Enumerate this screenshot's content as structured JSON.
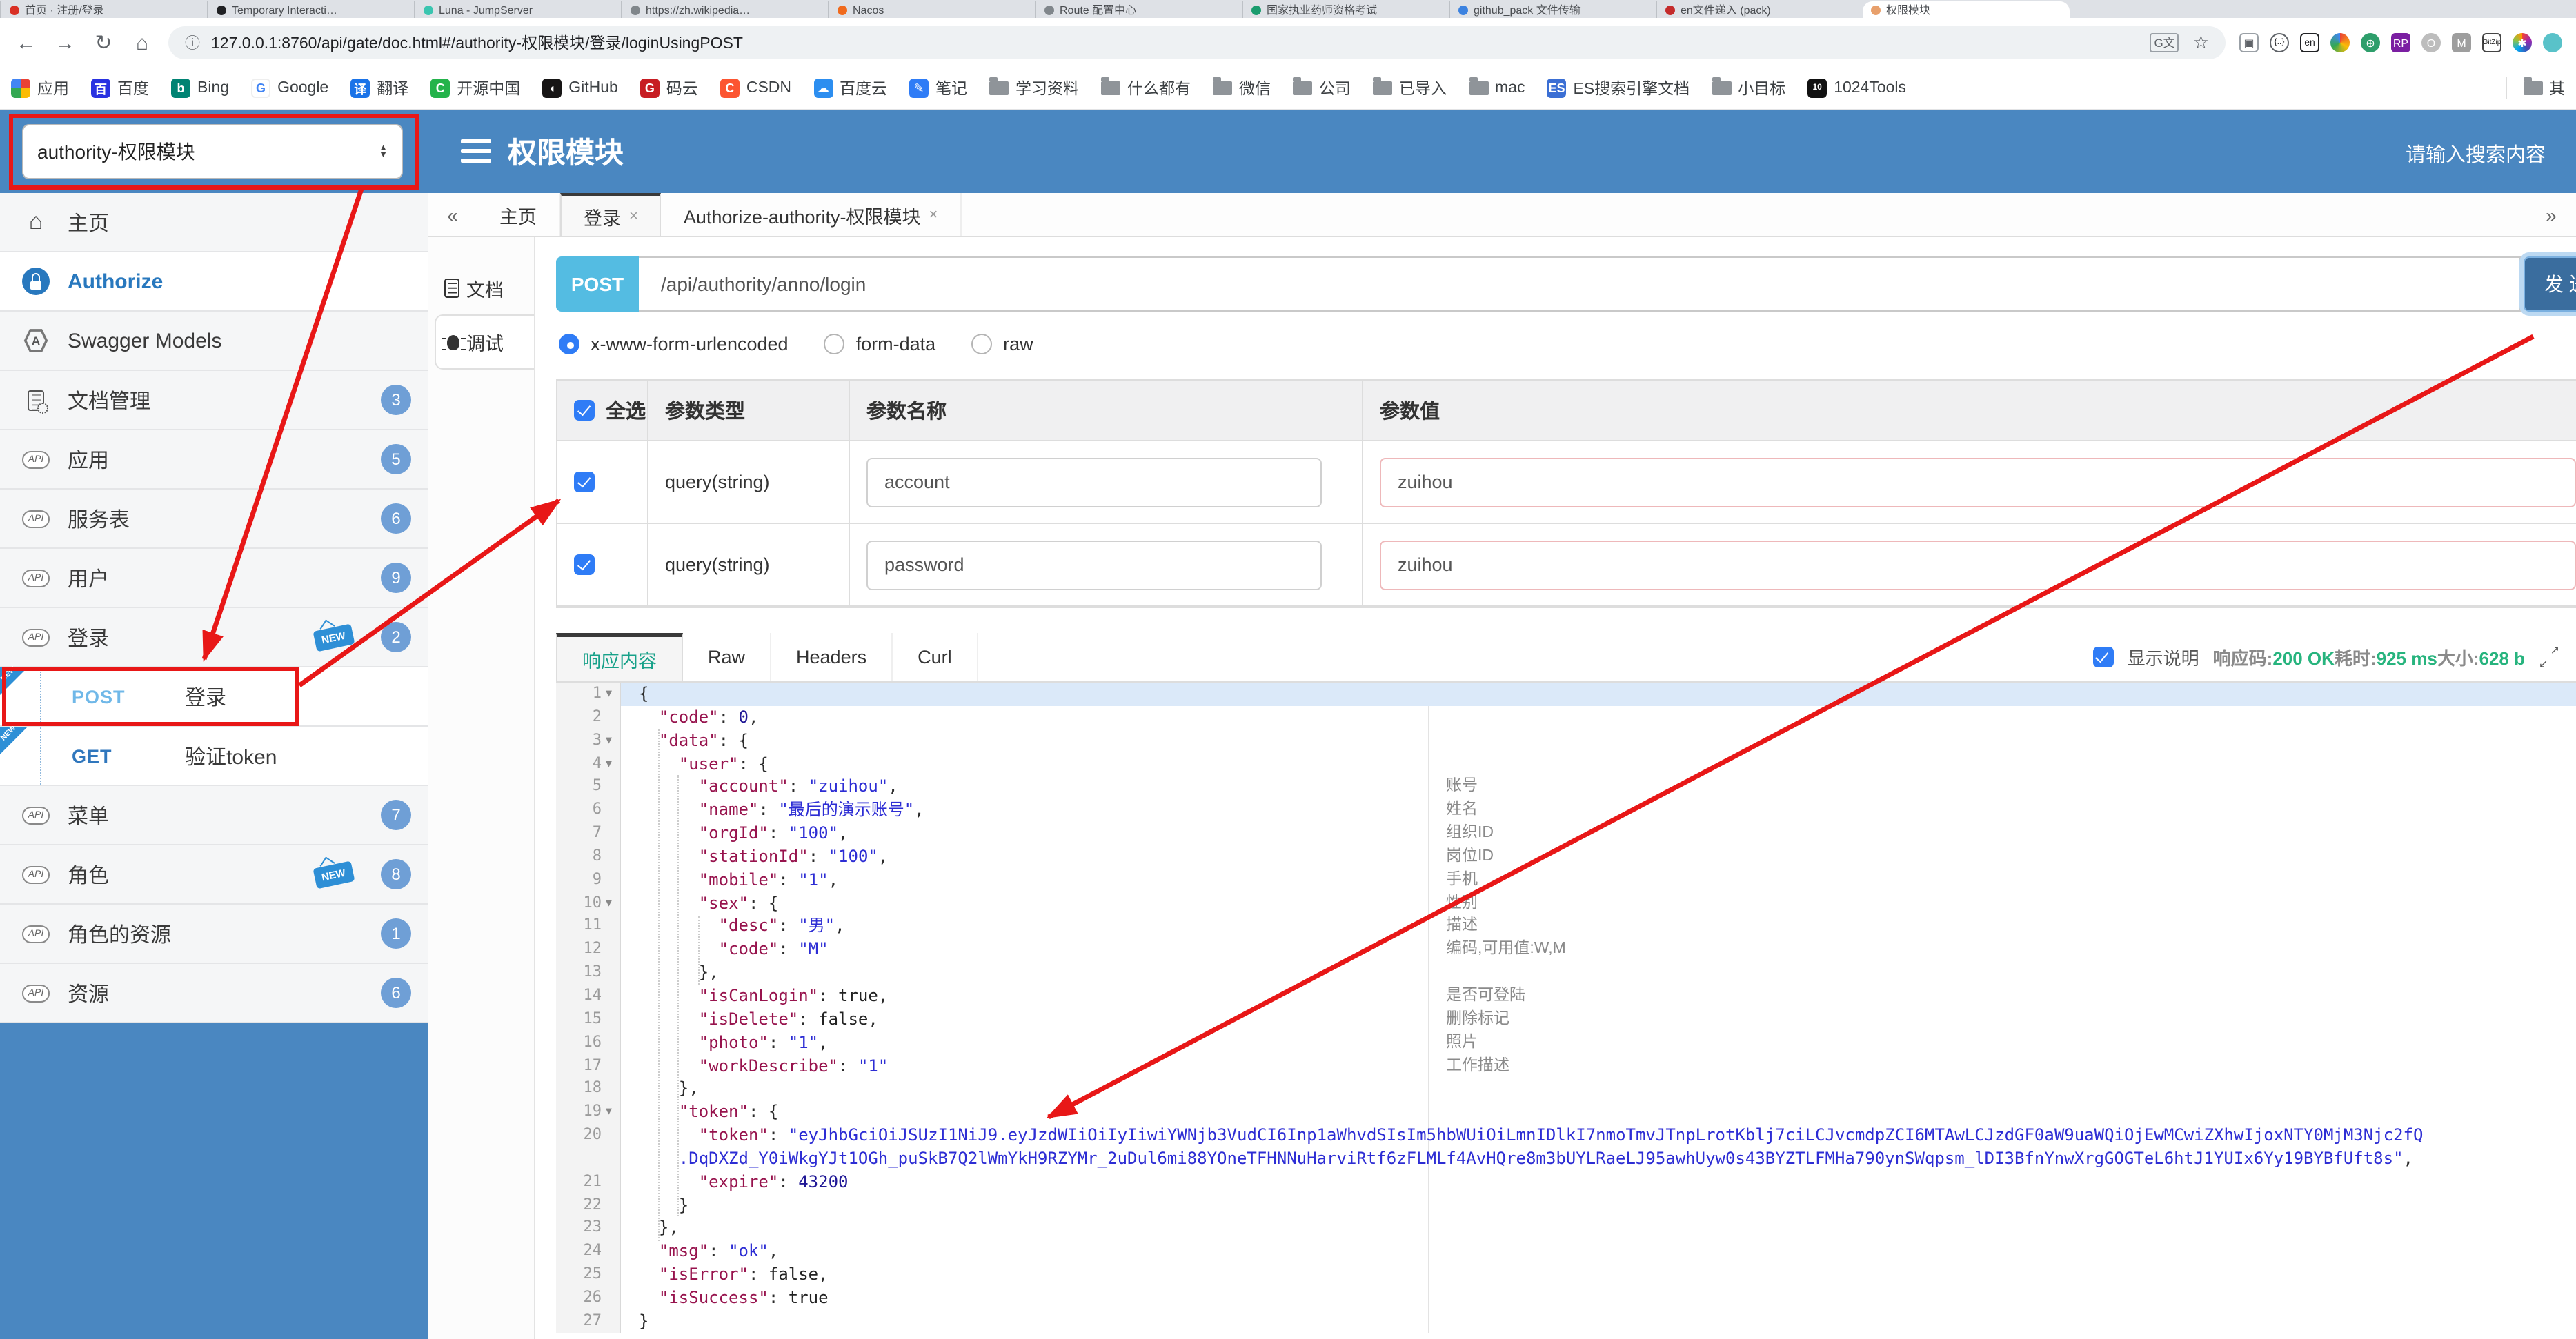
{
  "colors": {
    "header_blue": "#4a87c1",
    "annotation_red": "#e81717",
    "success_green": "#27b47e",
    "active_tab_teal": "#17a189",
    "method_post_chip": "#54bce2"
  },
  "browser": {
    "tabs": [
      {
        "label": "首页 · 注册/登录",
        "color": "#d93025"
      },
      {
        "label": "Temporary Interacti…",
        "color": "#202124"
      },
      {
        "label": "Luna - JumpServer",
        "color": "#3ac5b0"
      },
      {
        "label": "https://zh.wikipedia…",
        "color": "#80868b"
      },
      {
        "label": "Nacos",
        "color": "#f06a1d"
      },
      {
        "label": "Route 配置中心",
        "color": "#80868b"
      },
      {
        "label": "国家执业药师资格考试",
        "color": "#1a9c6e"
      },
      {
        "label": "github_pack 文件传输",
        "color": "#3b82e0"
      },
      {
        "label": "en文件递入 (pack)",
        "color": "#c42b2b"
      },
      {
        "label": "权限模块",
        "color": "#e8a06c",
        "active": true
      }
    ],
    "nav": {
      "url": "127.0.0.1:8760/api/gate/doc.html#/authority-权限模块/登录/loginUsingPOST"
    },
    "bookmarks": [
      {
        "label": "应用",
        "icon": "grid"
      },
      {
        "label": "百度",
        "icon": "baidu"
      },
      {
        "label": "Bing",
        "icon": "bing"
      },
      {
        "label": "Google",
        "icon": "google"
      },
      {
        "label": "翻译",
        "icon": "trans"
      },
      {
        "label": "开源中国",
        "icon": "osc"
      },
      {
        "label": "GitHub",
        "icon": "github"
      },
      {
        "label": "码云",
        "icon": "gitee"
      },
      {
        "label": "CSDN",
        "icon": "csdn"
      },
      {
        "label": "百度云",
        "icon": "bdcloud"
      },
      {
        "label": "笔记",
        "icon": "note"
      },
      {
        "label": "学习资料",
        "icon": "folder"
      },
      {
        "label": "什么都有",
        "icon": "folder"
      },
      {
        "label": "微信",
        "icon": "folder"
      },
      {
        "label": "公司",
        "icon": "folder"
      },
      {
        "label": "已导入",
        "icon": "folder"
      },
      {
        "label": "mac",
        "icon": "folder"
      },
      {
        "label": "ES搜索引擎文档",
        "icon": "es"
      },
      {
        "label": "小目标",
        "icon": "folder"
      },
      {
        "label": "1024Tools",
        "icon": "t1024"
      }
    ],
    "other_bookmarks_label": "其"
  },
  "header": {
    "module_select": "authority-权限模块",
    "title": "权限模块",
    "search_placeholder": "请输入搜索内容"
  },
  "sidebar": {
    "items": [
      {
        "label": "主页",
        "icon": "home"
      },
      {
        "label": "Authorize",
        "icon": "lock",
        "auth": true
      },
      {
        "label": "Swagger Models",
        "icon": "hex"
      },
      {
        "label": "文档管理",
        "icon": "docgear",
        "badge": "3"
      },
      {
        "label": "应用",
        "icon": "api",
        "badge": "5"
      },
      {
        "label": "服务表",
        "icon": "api",
        "badge": "6"
      },
      {
        "label": "用户",
        "icon": "api",
        "badge": "9"
      },
      {
        "label": "登录",
        "icon": "api",
        "badge": "2",
        "new": true
      },
      {
        "label": "登录",
        "method": "POST",
        "op": true,
        "new_corner": true
      },
      {
        "label": "验证token",
        "method": "GET",
        "op": true,
        "new_corner": true
      },
      {
        "label": "菜单",
        "icon": "api",
        "badge": "7"
      },
      {
        "label": "角色",
        "icon": "api",
        "badge": "8",
        "new": true
      },
      {
        "label": "角色的资源",
        "icon": "api",
        "badge": "1"
      },
      {
        "label": "资源",
        "icon": "api",
        "badge": "6"
      }
    ]
  },
  "workspace": {
    "collapse": "«",
    "expand": "»",
    "tabs": [
      {
        "label": "主页"
      },
      {
        "label": "登录",
        "close": "×",
        "active": true
      },
      {
        "label": "Authorize-authority-权限模块",
        "close": "×"
      }
    ],
    "doc_tabs": [
      {
        "label": "文档",
        "icon": "doc"
      },
      {
        "label": "调试",
        "icon": "bug",
        "active": true
      }
    ]
  },
  "request": {
    "method": "POST",
    "url": "/api/authority/anno/login",
    "send_label": "发送",
    "body_types": [
      {
        "label": "x-www-form-urlencoded",
        "selected": true
      },
      {
        "label": "form-data",
        "selected": false
      },
      {
        "label": "raw",
        "selected": false
      }
    ],
    "params": {
      "headers": [
        "全选",
        "参数类型",
        "参数名称",
        "参数值"
      ],
      "rows": [
        {
          "checked": true,
          "type": "query(string)",
          "name": "account",
          "value": "zuihou"
        },
        {
          "checked": true,
          "type": "query(string)",
          "name": "password",
          "value": "zuihou"
        }
      ]
    }
  },
  "response": {
    "tabs": [
      {
        "label": "响应内容",
        "active": true
      },
      {
        "label": "Raw"
      },
      {
        "label": "Headers"
      },
      {
        "label": "Curl"
      }
    ],
    "show_desc_label": "显示说明",
    "show_desc_checked": true,
    "status": [
      {
        "k": "响应码:",
        "v": "200 OK"
      },
      {
        "k": "耗时:",
        "v": "925 ms"
      },
      {
        "k": "大小:",
        "v": "628 b"
      }
    ]
  },
  "code": {
    "lines": [
      {
        "n": "1",
        "f": true,
        "act": true,
        "s": [
          [
            "p",
            "{"
          ]
        ]
      },
      {
        "n": "2",
        "s": [
          [
            "p",
            "  "
          ],
          [
            "k",
            "\"code\""
          ],
          [
            "p",
            ": "
          ],
          [
            "n",
            "0"
          ],
          [
            "p",
            ","
          ]
        ]
      },
      {
        "n": "3",
        "f": true,
        "s": [
          [
            "p",
            "  "
          ],
          [
            "k",
            "\"data\""
          ],
          [
            "p",
            ": {"
          ]
        ]
      },
      {
        "n": "4",
        "f": true,
        "s": [
          [
            "p",
            "    "
          ],
          [
            "k",
            "\"user\""
          ],
          [
            "p",
            ": {"
          ]
        ]
      },
      {
        "n": "5",
        "c": "账号",
        "s": [
          [
            "p",
            "      "
          ],
          [
            "k",
            "\"account\""
          ],
          [
            "p",
            ": "
          ],
          [
            "s",
            "\"zuihou\""
          ],
          [
            "p",
            ","
          ]
        ]
      },
      {
        "n": "6",
        "c": "姓名",
        "s": [
          [
            "p",
            "      "
          ],
          [
            "k",
            "\"name\""
          ],
          [
            "p",
            ": "
          ],
          [
            "s",
            "\"最后的演示账号\""
          ],
          [
            "p",
            ","
          ]
        ]
      },
      {
        "n": "7",
        "c": "组织ID",
        "s": [
          [
            "p",
            "      "
          ],
          [
            "k",
            "\"orgId\""
          ],
          [
            "p",
            ": "
          ],
          [
            "s",
            "\"100\""
          ],
          [
            "p",
            ","
          ]
        ]
      },
      {
        "n": "8",
        "c": "岗位ID",
        "s": [
          [
            "p",
            "      "
          ],
          [
            "k",
            "\"stationId\""
          ],
          [
            "p",
            ": "
          ],
          [
            "s",
            "\"100\""
          ],
          [
            "p",
            ","
          ]
        ]
      },
      {
        "n": "9",
        "c": "手机",
        "s": [
          [
            "p",
            "      "
          ],
          [
            "k",
            "\"mobile\""
          ],
          [
            "p",
            ": "
          ],
          [
            "s",
            "\"1\""
          ],
          [
            "p",
            ","
          ]
        ]
      },
      {
        "n": "10",
        "f": true,
        "c": "性别",
        "s": [
          [
            "p",
            "      "
          ],
          [
            "k",
            "\"sex\""
          ],
          [
            "p",
            ": {"
          ]
        ]
      },
      {
        "n": "11",
        "c": "描述",
        "s": [
          [
            "p",
            "        "
          ],
          [
            "k",
            "\"desc\""
          ],
          [
            "p",
            ": "
          ],
          [
            "s",
            "\"男\""
          ],
          [
            "p",
            ","
          ]
        ]
      },
      {
        "n": "12",
        "c": "编码,可用值:W,M",
        "s": [
          [
            "p",
            "        "
          ],
          [
            "k",
            "\"code\""
          ],
          [
            "p",
            ": "
          ],
          [
            "s",
            "\"M\""
          ]
        ]
      },
      {
        "n": "13",
        "s": [
          [
            "p",
            "      },"
          ]
        ]
      },
      {
        "n": "14",
        "c": "是否可登陆",
        "s": [
          [
            "p",
            "      "
          ],
          [
            "k",
            "\"isCanLogin\""
          ],
          [
            "p",
            ": "
          ],
          [
            "b",
            "true"
          ],
          [
            "p",
            ","
          ]
        ]
      },
      {
        "n": "15",
        "c": "删除标记",
        "s": [
          [
            "p",
            "      "
          ],
          [
            "k",
            "\"isDelete\""
          ],
          [
            "p",
            ": "
          ],
          [
            "b",
            "false"
          ],
          [
            "p",
            ","
          ]
        ]
      },
      {
        "n": "16",
        "c": "照片",
        "s": [
          [
            "p",
            "      "
          ],
          [
            "k",
            "\"photo\""
          ],
          [
            "p",
            ": "
          ],
          [
            "s",
            "\"1\""
          ],
          [
            "p",
            ","
          ]
        ]
      },
      {
        "n": "17",
        "c": "工作描述",
        "s": [
          [
            "p",
            "      "
          ],
          [
            "k",
            "\"workDescribe\""
          ],
          [
            "p",
            ": "
          ],
          [
            "s",
            "\"1\""
          ]
        ]
      },
      {
        "n": "18",
        "s": [
          [
            "p",
            "    },"
          ]
        ]
      },
      {
        "n": "19",
        "f": true,
        "s": [
          [
            "p",
            "    "
          ],
          [
            "k",
            "\"token\""
          ],
          [
            "p",
            ": {"
          ]
        ]
      },
      {
        "n": "20",
        "s": [
          [
            "p",
            "      "
          ],
          [
            "k",
            "\"token\""
          ],
          [
            "p",
            ": "
          ],
          [
            "s",
            "\"eyJhbGciOiJSUzI1NiJ9.eyJzdWIiOiIyIiwiYWNjb3VudCI6Inp1aWhvdSIsIm5hbWUiOiLmnIDlkI7nmoTmvJTnpLrotKblj7ciLCJvcmdpZCI6MTAwLCJzdGF0aW9uaWQiOjEwMCwiZXhwIjoxNTY0MjM3Njc2fQ"
          ]
        ]
      },
      {
        "n": "",
        "s": [
          [
            "s",
            "    .DqDXZd_Y0iWkgYJt1OGh_puSkB7Q2lWmYkH9RZYMr_2uDul6mi88YOneTFHNNuHarviRtf6zFLMLf4AvHQre8m3bUYLRaeLJ95awhUyw0s43BYZTLFMHa790ynSWqpsm_lDI3BfnYnwXrgGOGTeL6htJ1YUIx6Yy19BYBfUft8s\""
          ],
          [
            "p",
            ","
          ]
        ]
      },
      {
        "n": "21",
        "s": [
          [
            "p",
            "      "
          ],
          [
            "k",
            "\"expire\""
          ],
          [
            "p",
            ": "
          ],
          [
            "n",
            "43200"
          ]
        ]
      },
      {
        "n": "22",
        "s": [
          [
            "p",
            "    }"
          ]
        ]
      },
      {
        "n": "23",
        "s": [
          [
            "p",
            "  },"
          ]
        ]
      },
      {
        "n": "24",
        "s": [
          [
            "p",
            "  "
          ],
          [
            "k",
            "\"msg\""
          ],
          [
            "p",
            ": "
          ],
          [
            "s",
            "\"ok\""
          ],
          [
            "p",
            ","
          ]
        ]
      },
      {
        "n": "25",
        "s": [
          [
            "p",
            "  "
          ],
          [
            "k",
            "\"isError\""
          ],
          [
            "p",
            ": "
          ],
          [
            "b",
            "false"
          ],
          [
            "p",
            ","
          ]
        ]
      },
      {
        "n": "26",
        "s": [
          [
            "p",
            "  "
          ],
          [
            "k",
            "\"isSuccess\""
          ],
          [
            "p",
            ": "
          ],
          [
            "b",
            "true"
          ]
        ]
      },
      {
        "n": "27",
        "s": [
          [
            "p",
            "}"
          ]
        ]
      }
    ]
  }
}
